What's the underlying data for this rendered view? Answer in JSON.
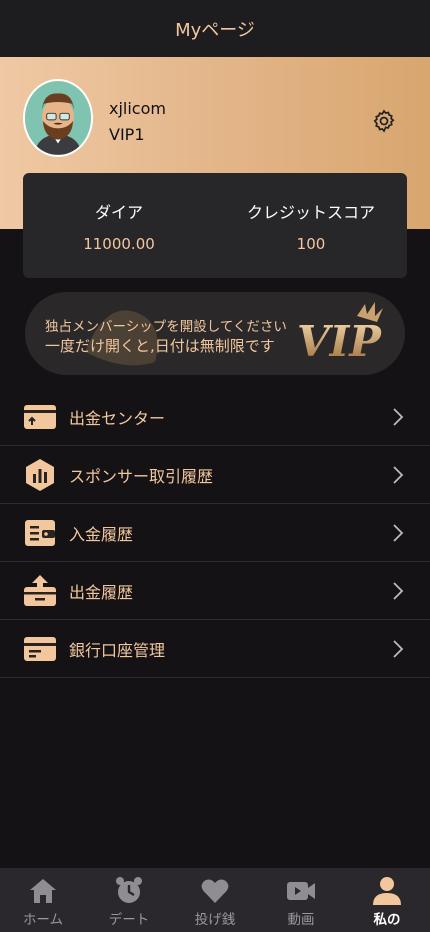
{
  "header": {
    "title": "Myページ"
  },
  "profile": {
    "username": "xjlicom",
    "level": "VIP1"
  },
  "stats": [
    {
      "label": "ダイア",
      "value": "11000.00"
    },
    {
      "label": "クレジットスコア",
      "value": "100"
    }
  ],
  "banner": {
    "line1": "独占メンバーシップを開設してください",
    "line2": "一度だけ開くと,日付は無制限です",
    "logo_text": "VIP"
  },
  "menu": [
    {
      "label": "出金センター",
      "icon": "withdraw-center-icon"
    },
    {
      "label": "スポンサー取引履歴",
      "icon": "chart-hexagon-icon"
    },
    {
      "label": "入金履歴",
      "icon": "wallet-icon"
    },
    {
      "label": "出金履歴",
      "icon": "withdraw-box-icon"
    },
    {
      "label": "銀行口座管理",
      "icon": "bank-card-icon"
    }
  ],
  "tabs": [
    {
      "label": "ホーム",
      "icon": "home-icon"
    },
    {
      "label": "デート",
      "icon": "alarm-clock-icon"
    },
    {
      "label": "投げ銭",
      "icon": "heart-icon"
    },
    {
      "label": "動画",
      "icon": "video-camera-icon"
    },
    {
      "label": "私の",
      "icon": "person-icon",
      "active": true
    }
  ],
  "colors": {
    "accent": "#f2c79e",
    "background": "#141215",
    "header": "#1d1c1e",
    "card": "#272629"
  }
}
